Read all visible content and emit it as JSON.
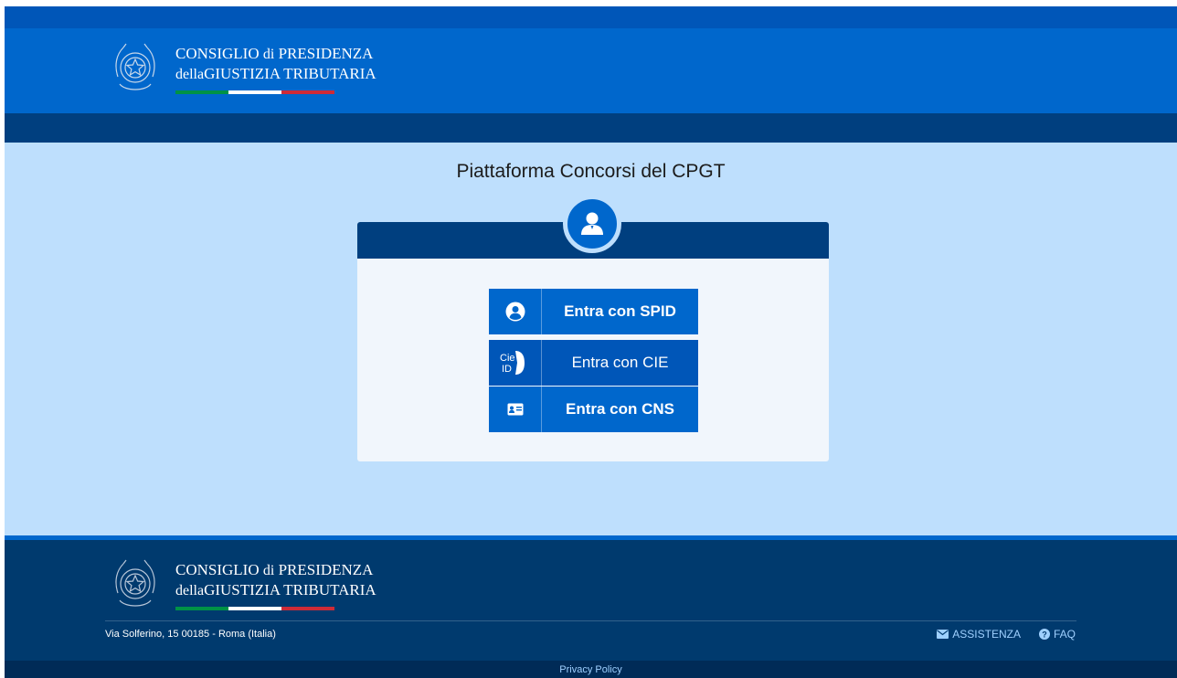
{
  "header": {
    "brand_line1": "CONSIGLIO",
    "brand_di": "di",
    "brand_line1b": "PRESIDENZA",
    "brand_della": "della",
    "brand_line2": "GIUSTIZIA TRIBUTARIA"
  },
  "main": {
    "title": "Piattaforma Concorsi del CPGT",
    "buttons": [
      {
        "icon": "user-circle-icon",
        "label": "Entra con SPID"
      },
      {
        "icon": "cie-id-icon",
        "label": "Entra con CIE"
      },
      {
        "icon": "id-card-icon",
        "label": "Entra con CNS"
      }
    ]
  },
  "footer": {
    "address": "Via Solferino, 15 00185 - Roma (Italia)",
    "links": [
      {
        "icon": "envelope-icon",
        "label": "ASSISTENZA"
      },
      {
        "icon": "question-circle-icon",
        "label": "FAQ"
      }
    ],
    "privacy": "Privacy Policy"
  },
  "colors": {
    "primary": "#0067cc",
    "dark": "#003f7f",
    "background": "#bedffd",
    "tricolor_green": "#009246",
    "tricolor_white": "#ffffff",
    "tricolor_red": "#ce2b37"
  }
}
